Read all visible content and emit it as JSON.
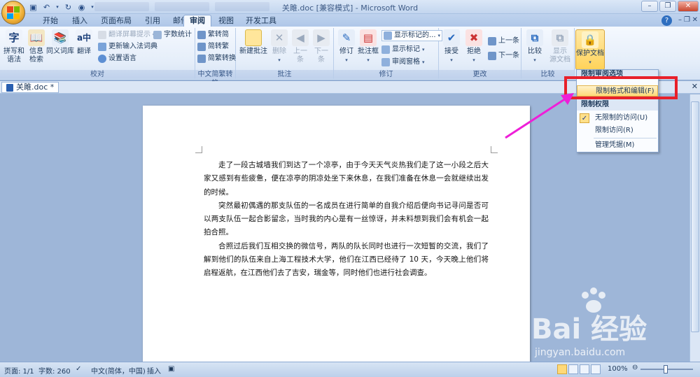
{
  "window": {
    "title": "关雎.doc [兼容模式] - Microsoft Word",
    "controls": [
      "–",
      "❐",
      "✕"
    ]
  },
  "tabs": [
    {
      "label": "开始",
      "active": false
    },
    {
      "label": "插入",
      "active": false
    },
    {
      "label": "页面布局",
      "active": false
    },
    {
      "label": "引用",
      "active": false
    },
    {
      "label": "邮件",
      "active": false
    },
    {
      "label": "审阅",
      "active": true
    },
    {
      "label": "视图",
      "active": false
    },
    {
      "label": "开发工具",
      "active": false
    }
  ],
  "ribbon": {
    "proofing": {
      "label": "校对",
      "spell": "拼写和\n语法",
      "research": "信息\n检索",
      "thesaurus": "同义词库",
      "translate": "翻译",
      "translate_tip": "翻译屏幕提示",
      "update_ime": "更新输入法词典",
      "set_language": "设置语言",
      "word_count": "字数统计",
      "spell_icon_text": "字",
      "translate_icon_text": "a中"
    },
    "chinese_conversion": {
      "label": "中文简繁转换",
      "to_trad": "繁转简",
      "to_simp": "简转繁",
      "convert": "简繁转换"
    },
    "comments": {
      "label": "批注",
      "new": "新建批注",
      "delete": "删除",
      "prev": "上一\n条",
      "next": "下一\n条"
    },
    "tracking": {
      "label": "修订",
      "track": "修订",
      "balloons": "批注框",
      "show_markup_select": "显示标记的...",
      "show_markup": "显示标记",
      "review_pane": "审阅窗格"
    },
    "changes": {
      "label": "更改",
      "accept": "接受",
      "reject": "拒绝",
      "prev": "上一条",
      "next": "下一条"
    },
    "compare": {
      "label": "比较",
      "compare": "比较",
      "show_source": "显示\n源文档"
    },
    "protect": {
      "protect_doc": "保护文档"
    }
  },
  "doc_tab": {
    "name": "关雎.doc *"
  },
  "document": {
    "paragraphs": [
      "走了一段古城墙我们到达了一个凉亭，由于今天天气炎热我们走了这一小段之后大家又感到有些疲惫，便在凉亭的阴凉处坐下来休息，在我们准备在休息一会就继续出发的时候。",
      "突然最初偶遇的那支队伍的一名成员在进行简单的自我介绍后便向书记寻问是否可以两支队伍一起合影留念，当时我的内心是有一丝惊讶，并未料想到我们会有机会一起拍合照。",
      "合照过后我们互相交换的微信号，两队的队长同时也进行一次短暂的交流，我们了解到他们的队伍来自上海工程技术大学，他们在江西已经待了 10 天，今天晚上他们将启程返航，在江西他们去了吉安，瑞金等，同时他们也进行社会调查。"
    ]
  },
  "protect_menu": {
    "header1": "限制审阅选项",
    "item_format": "限制格式和编辑(F)",
    "header2": "限制权限",
    "item_unrestricted": "无限制的访问(U)",
    "item_restricted": "限制访问(R)",
    "item_manage": "管理凭据(M)",
    "check_mark": "✓"
  },
  "statusbar": {
    "page": "页面: 1/1",
    "words": "字数: 260",
    "language": "中文(简体，中国)",
    "insert_mode": "插入",
    "zoom": "100%"
  },
  "watermark": {
    "brand": "Bai  经验",
    "url": "jingyan.baidu.com"
  },
  "colors": {
    "accent_red": "#e8202a",
    "arrow_magenta": "#ee1fd8",
    "ribbon_bg": "#e4edf9",
    "workspace_bg": "#9eb6d8"
  }
}
